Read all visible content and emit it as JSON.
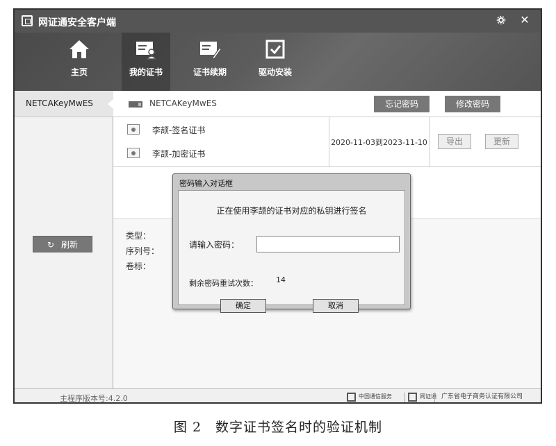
{
  "window": {
    "title": "网证通安全客户端",
    "controls": {
      "settings_icon": "gear-icon",
      "close_icon": "close-icon",
      "close_glyph": "✕"
    }
  },
  "toolbar": {
    "items": [
      {
        "label": "主页",
        "icon": "home-icon",
        "active": false
      },
      {
        "label": "我的证书",
        "icon": "certificate-user-icon",
        "active": true
      },
      {
        "label": "证书续期",
        "icon": "certificate-edit-icon",
        "active": false
      },
      {
        "label": "驱动安装",
        "icon": "checkbox-install-icon",
        "active": false
      }
    ]
  },
  "sidebar": {
    "device_tab": "NETCAKeyMwES",
    "refresh_label": "刷新",
    "refresh_glyph": "↻"
  },
  "device_bar": {
    "device_name": "NETCAKeyMwES",
    "forgot_password": "忘记密码",
    "change_password": "修改密码"
  },
  "certificates": {
    "items": [
      {
        "name": "李颉-签名证书"
      },
      {
        "name": "李颉-加密证书"
      }
    ],
    "validity": "2020-11-03到2023-11-10",
    "export_label": "导出",
    "update_label": "更新"
  },
  "details": {
    "type_label": "类型：",
    "serial_label": "序列号：",
    "volume_label": "卷标："
  },
  "dialog": {
    "title": "密码输入对话框",
    "message": "正在使用李颉的证书对应的私钥进行签名",
    "password_label": "请输入密码：",
    "password_value": "",
    "retry_label": "剩余密码重试次数：",
    "retry_count": "14",
    "ok_label": "确定",
    "cancel_label": "取消"
  },
  "statusbar": {
    "version": "主程序版本号:4.2.0",
    "logos": [
      {
        "name": "china-commerce-logo",
        "text": "中国通信服务"
      },
      {
        "name": "netca-logo",
        "text": "网证通"
      },
      {
        "name": "gd-certification-logo",
        "text": "广东省电子商务认证有限公司"
      }
    ]
  },
  "caption": "图 2　数字证书签名时的验证机制"
}
